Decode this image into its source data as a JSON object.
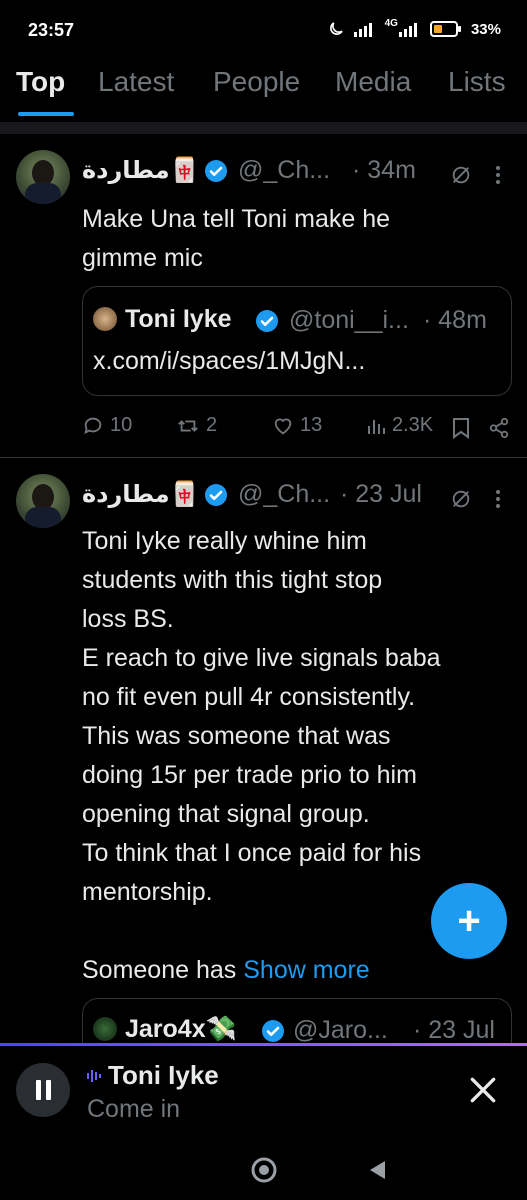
{
  "status_bar": {
    "time": "23:57",
    "battery": "33%",
    "network": "4G",
    "icons": [
      "moon-icon",
      "signal-icon",
      "signal-4g-icon",
      "battery-icon"
    ]
  },
  "tabs": [
    {
      "label": "Top",
      "active": true
    },
    {
      "label": "Latest",
      "active": false
    },
    {
      "label": "People",
      "active": false
    },
    {
      "label": "Media",
      "active": false
    },
    {
      "label": "Lists",
      "active": false
    }
  ],
  "tweets": [
    {
      "display_name": "مطاردة🀄",
      "handle": "@_Ch...",
      "time": "· 34m",
      "text": "Make Una tell Toni make he\ngimme mic",
      "quote": {
        "display_name": "Toni Iyke",
        "handle": "@toni__i...",
        "time": "· 48m",
        "text": "x.com/i/spaces/1MJgN..."
      },
      "stats": {
        "replies": "10",
        "retweets": "2",
        "likes": "13",
        "views": "2.3K"
      }
    },
    {
      "display_name": "مطاردة🀄",
      "handle": "@_Ch...",
      "time": "· 23 Jul",
      "text": "Toni Iyke really whine him\nstudents with this tight stop\nloss BS.\nE reach to give live signals baba\nno fit even pull 4r consistently.\nThis was someone that was\ndoing 15r per trade prio to him\nopening that signal group.\nTo think that I once paid for his\nmentorship.\n\nSomeone has",
      "show_more": "Show more",
      "quote": {
        "display_name": "Jaro4x💸",
        "handle": "@Jaro...",
        "time": "· 23 Jul"
      }
    }
  ],
  "fab": {
    "label": "+"
  },
  "space": {
    "title": "Toni Iyke",
    "subtitle": "Come in"
  },
  "colors": {
    "accent": "#1d9bf0",
    "background": "#000000",
    "muted": "#71767b",
    "text": "#e7e9ea"
  }
}
